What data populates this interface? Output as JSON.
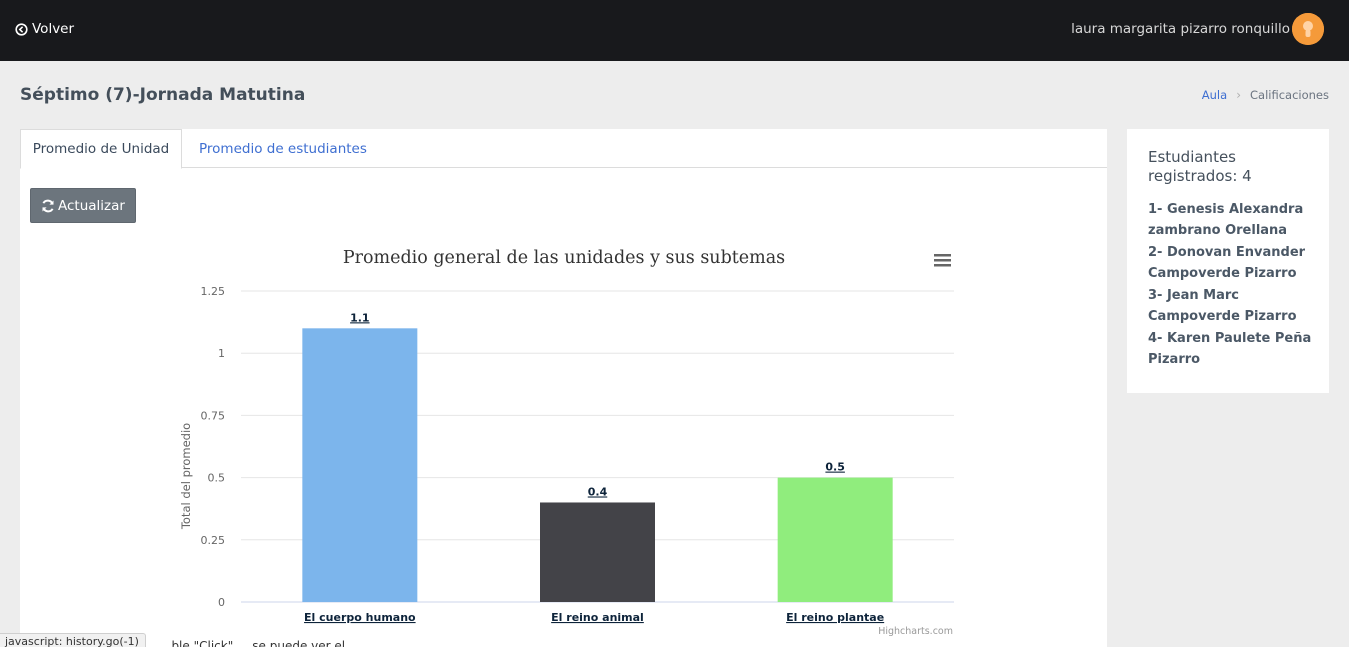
{
  "topbar": {
    "back_label": "Volver",
    "user_name": "laura margarita pizarro ronquillo"
  },
  "header": {
    "title": "Séptimo (7)-Jornada Matutina",
    "breadcrumb": {
      "link": "Aula",
      "current": "Calificaciones"
    }
  },
  "tabs": [
    {
      "label": "Promedio de Unidad",
      "active": true
    },
    {
      "label": "Promedio de estudiantes",
      "active": false
    }
  ],
  "refresh_label": "Actualizar",
  "chart_data": {
    "type": "bar",
    "title": "Promedio general de las unidades y sus subtemas",
    "ylabel": "Total del promedio",
    "xlabel": "",
    "categories": [
      "El cuerpo humano",
      "El reino animal",
      "El reino plantae"
    ],
    "values": [
      1.1,
      0.4,
      0.5
    ],
    "value_labels": [
      "1.1",
      "0.4",
      "0.5"
    ],
    "colors": [
      "#7cb5ec",
      "#434348",
      "#90ed7d"
    ],
    "ylim": [
      0,
      1.25
    ],
    "yticks": [
      "0",
      "0.25",
      "0.5",
      "0.75",
      "1",
      "1.25"
    ],
    "grid": true,
    "credits": "Highcharts.com"
  },
  "footnote": "...ble \"Click\" ... se puede ver el ...",
  "sidebar": {
    "title": "Estudiantes registrados: 4",
    "students": [
      "1- Genesis Alexandra zambrano Orellana",
      "2- Donovan Envander Campoverde Pizarro",
      "3- Jean Marc Campoverde Pizarro",
      "4- Karen Paulete Peña Pizarro"
    ]
  },
  "status_bar": "javascript: history.go(-1)",
  "colors": {
    "accent": "#3f6fd1",
    "navbar": "#18191c",
    "avatar": "#f59a3a"
  },
  "icons": {
    "back": "circle-arrow-left-icon",
    "refresh": "refresh-icon",
    "menu": "hamburger-menu-icon",
    "avatar": "user-avatar-icon"
  }
}
